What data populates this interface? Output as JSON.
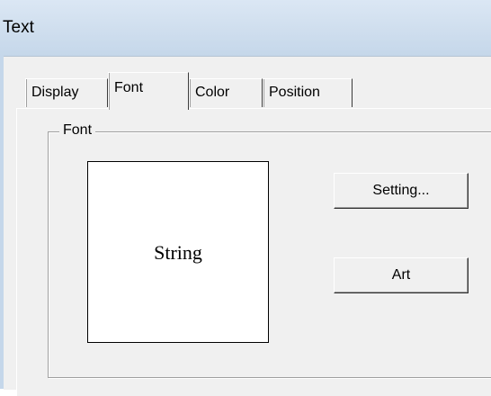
{
  "window": {
    "title": "Text"
  },
  "tabs": [
    {
      "label": "Display",
      "selected": false
    },
    {
      "label": "Font",
      "selected": true
    },
    {
      "label": "Color",
      "selected": false
    },
    {
      "label": "Position",
      "selected": false
    }
  ],
  "font_group": {
    "label": "Font",
    "preview_text": "String",
    "setting_button": "Setting...",
    "art_button": "Art"
  }
}
